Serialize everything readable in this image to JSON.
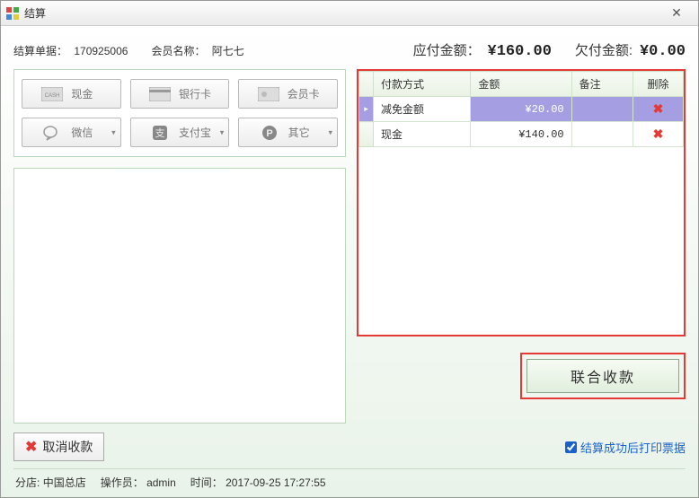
{
  "window": {
    "title": "结算"
  },
  "info": {
    "order_label": "结算单据：",
    "order_no": "170925006",
    "member_label": "会员名称：",
    "member_name": "阿七七"
  },
  "amounts": {
    "due_label": "应付金额：",
    "due_value": "¥160.00",
    "owed_label": "欠付金额:",
    "owed_value": "¥0.00"
  },
  "pay_methods": {
    "cash": "现金",
    "bank": "银行卡",
    "member": "会员卡",
    "wechat": "微信",
    "alipay": "支付宝",
    "other": "其它"
  },
  "table": {
    "headers": {
      "method": "付款方式",
      "amount": "金额",
      "remark": "备注",
      "delete": "删除"
    },
    "rows": [
      {
        "method": "减免金额",
        "amount": "¥20.00",
        "remark": "",
        "selected": true
      },
      {
        "method": "现金",
        "amount": "¥140.00",
        "remark": "",
        "selected": false
      }
    ],
    "delete_glyph": "✖"
  },
  "actions": {
    "confirm": "联合收款",
    "cancel": "取消收款",
    "print_label": "结算成功后打印票据",
    "print_checked": true
  },
  "status": {
    "store_label": "分店:",
    "store": "中国总店",
    "operator_label": "操作员：",
    "operator": "admin",
    "time_label": "时间：",
    "time": "2017-09-25 17:27:55"
  },
  "glyphs": {
    "dropdown": "▾",
    "row_indicator": "▸"
  }
}
